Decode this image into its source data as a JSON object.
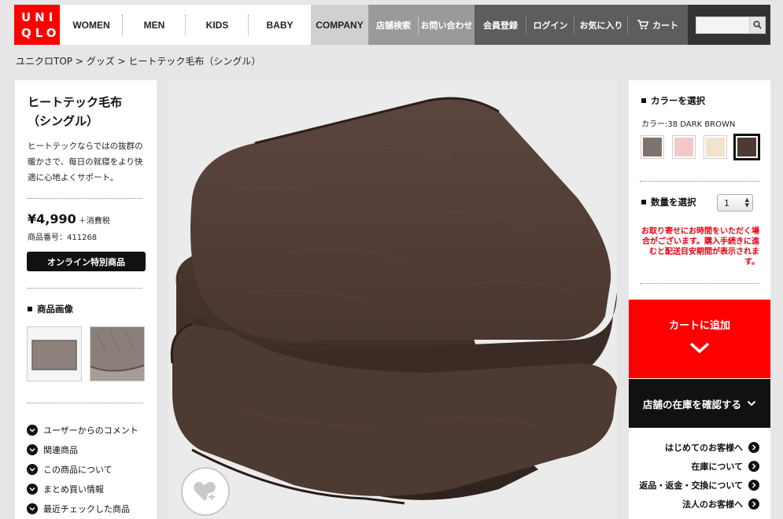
{
  "header": {
    "logo_lines": [
      "UNI",
      "QLO"
    ],
    "nav_main": [
      "WOMEN",
      "MEN",
      "KIDS",
      "BABY",
      "COMPANY"
    ],
    "nav_grey": [
      "店舗検索",
      "お問い合わせ"
    ],
    "nav_dark": [
      "会員登録",
      "ログイン",
      "お気に入り",
      "カート"
    ],
    "search_placeholder": ""
  },
  "breadcrumb": "ユニクロTOP > グッズ > ヒートテック毛布（シングル）",
  "product": {
    "title_line1": "ヒートテック毛布",
    "title_line2": "（シングル）",
    "description": "ヒートテックならではの抜群の暖かさで、毎日の就寝をより快適に心地よくサポート。",
    "price": "¥4,990",
    "tax": "＋消費税",
    "product_number": "商品番号：411268",
    "online_badge": "オンライン特別商品",
    "images_heading": "商品画像"
  },
  "side_links": [
    "ユーザーからのコメント",
    "関連商品",
    "この商品について",
    "まとめ買い情報",
    "最近チェックした商品"
  ],
  "purchase": {
    "color_heading": "カラーを選択",
    "color_label": "カラー:38 DARK BROWN",
    "swatches": [
      "#7d746f",
      "#f2c9c9",
      "#f3e3cc",
      "#4e3a33"
    ],
    "selected_swatch": 3,
    "qty_heading": "数量を選択",
    "qty_value": "1",
    "notice": "お取り寄せにお時間をいただく場合がございます。購入手続きに進むと配送目安期間が表示されます。",
    "cart_button": "カートに追加",
    "stock_button": "店舗の在庫を確認する"
  },
  "info_links": [
    "はじめてのお客様へ",
    "在庫について",
    "返品・返金・交換について",
    "法人のお客様へ"
  ],
  "colors": {
    "accent": "#ff0000",
    "dark": "#111111",
    "notice": "#e60012"
  }
}
